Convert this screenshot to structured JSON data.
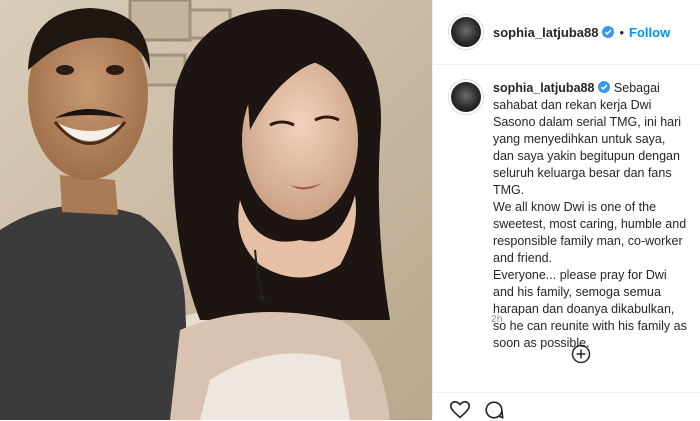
{
  "post": {
    "username": "sophia_latjuba88",
    "follow_label": "Follow",
    "separator": "•",
    "caption": "Sebagai sahabat dan rekan kerja Dwi Sasono dalam serial TMG, ini hari yang menyedihkan untuk saya, dan saya yakin begitupun dengan seluruh keluarga besar dan fans TMG.\nWe all know Dwi is one of the sweetest, most caring, humble and responsible family man, co-worker and friend.\nEveryone... please pray for Dwi and his family, semoga semua harapan dan doanya dikabulkan, so he can reunite with his family as soon as possible.",
    "timestamp": "2h"
  },
  "colors": {
    "link_blue": "#0095f6",
    "verified_blue": "#3897f0",
    "muted": "#8e8e8e"
  },
  "icons": {
    "verified": "verified-badge-icon",
    "add_comment": "plus-circle-icon",
    "like": "heart-icon",
    "comment": "comment-icon"
  }
}
